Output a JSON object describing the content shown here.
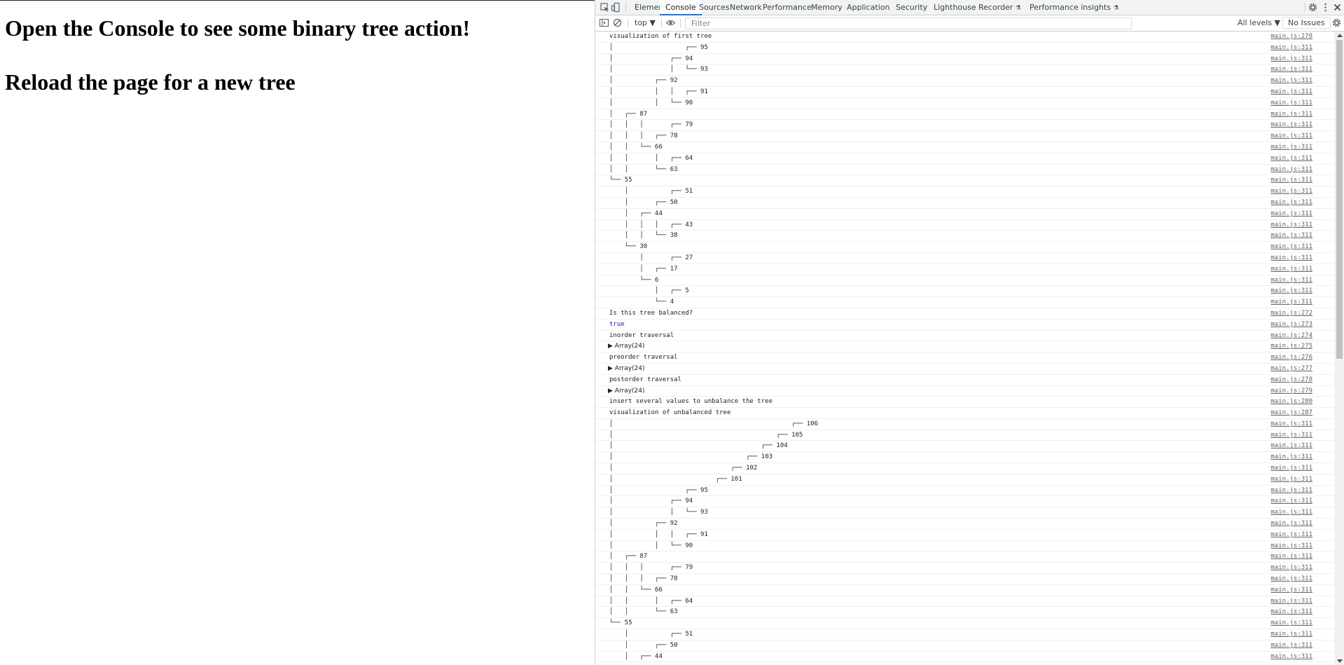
{
  "page": {
    "heading1": "Open the Console to see some binary tree action!",
    "heading2": "Reload the page for a new tree"
  },
  "devtools": {
    "tabs": [
      "Elements",
      "Console",
      "Sources",
      "Network",
      "Performance",
      "Memory",
      "Application",
      "Security",
      "Lighthouse",
      "Recorder",
      "Performance insights"
    ],
    "active_tab": "Console",
    "context": "top ▼",
    "filter_placeholder": "Filter",
    "levels": "All levels ▼",
    "issues": "No Issues"
  },
  "console": [
    {
      "text": "visualization of first tree",
      "src": "main.js:270"
    },
    {
      "text": "│                   ┌── 95",
      "src": "main.js:311"
    },
    {
      "text": "│               ┌── 94",
      "src": "main.js:311"
    },
    {
      "text": "│               │   └── 93",
      "src": "main.js:311"
    },
    {
      "text": "│           ┌── 92",
      "src": "main.js:311"
    },
    {
      "text": "│           │   │   ┌── 91",
      "src": "main.js:311"
    },
    {
      "text": "│           │   └── 90",
      "src": "main.js:311"
    },
    {
      "text": "│   ┌── 87",
      "src": "main.js:311"
    },
    {
      "text": "│   │   │       ┌── 79",
      "src": "main.js:311"
    },
    {
      "text": "│   │   │   ┌── 78",
      "src": "main.js:311"
    },
    {
      "text": "│   │   └── 66",
      "src": "main.js:311"
    },
    {
      "text": "│   │       │   ┌── 64",
      "src": "main.js:311"
    },
    {
      "text": "│   │       └── 63",
      "src": "main.js:311"
    },
    {
      "text": "└── 55",
      "src": "main.js:311"
    },
    {
      "text": "    │           ┌── 51",
      "src": "main.js:311"
    },
    {
      "text": "    │       ┌── 50",
      "src": "main.js:311"
    },
    {
      "text": "    │   ┌── 44",
      "src": "main.js:311"
    },
    {
      "text": "    │   │   │   ┌── 43",
      "src": "main.js:311"
    },
    {
      "text": "    │   │   └── 38",
      "src": "main.js:311"
    },
    {
      "text": "    └── 30",
      "src": "main.js:311"
    },
    {
      "text": "        │       ┌── 27",
      "src": "main.js:311"
    },
    {
      "text": "        │   ┌── 17",
      "src": "main.js:311"
    },
    {
      "text": "        └── 6",
      "src": "main.js:311"
    },
    {
      "text": "            │   ┌── 5",
      "src": "main.js:311"
    },
    {
      "text": "            └── 4",
      "src": "main.js:311"
    },
    {
      "text": "Is this tree balanced?",
      "src": "main.js:272"
    },
    {
      "text": "true",
      "src": "main.js:273",
      "kind": "bool"
    },
    {
      "text": "inorder traversal",
      "src": "main.js:274"
    },
    {
      "text": "▶ Array(24)",
      "src": "main.js:275",
      "kind": "arr"
    },
    {
      "text": "preorder traversal",
      "src": "main.js:276"
    },
    {
      "text": "▶ Array(24)",
      "src": "main.js:277",
      "kind": "arr"
    },
    {
      "text": "postorder traversal",
      "src": "main.js:278"
    },
    {
      "text": "▶ Array(24)",
      "src": "main.js:279",
      "kind": "arr"
    },
    {
      "text": "insert several values to unbalance the tree",
      "src": "main.js:280"
    },
    {
      "text": "visualization of unbalanced tree",
      "src": "main.js:287"
    },
    {
      "text": "│                                               ┌── 106",
      "src": "main.js:311"
    },
    {
      "text": "│                                           ┌── 105",
      "src": "main.js:311"
    },
    {
      "text": "│                                       ┌── 104",
      "src": "main.js:311"
    },
    {
      "text": "│                                   ┌── 103",
      "src": "main.js:311"
    },
    {
      "text": "│                               ┌── 102",
      "src": "main.js:311"
    },
    {
      "text": "│                           ┌── 101",
      "src": "main.js:311"
    },
    {
      "text": "│                   ┌── 95",
      "src": "main.js:311"
    },
    {
      "text": "│               ┌── 94",
      "src": "main.js:311"
    },
    {
      "text": "│               │   └── 93",
      "src": "main.js:311"
    },
    {
      "text": "│           ┌── 92",
      "src": "main.js:311"
    },
    {
      "text": "│           │   │   ┌── 91",
      "src": "main.js:311"
    },
    {
      "text": "│           │   └── 90",
      "src": "main.js:311"
    },
    {
      "text": "│   ┌── 87",
      "src": "main.js:311"
    },
    {
      "text": "│   │   │       ┌── 79",
      "src": "main.js:311"
    },
    {
      "text": "│   │   │   ┌── 78",
      "src": "main.js:311"
    },
    {
      "text": "│   │   └── 66",
      "src": "main.js:311"
    },
    {
      "text": "│   │       │   ┌── 64",
      "src": "main.js:311"
    },
    {
      "text": "│   │       └── 63",
      "src": "main.js:311"
    },
    {
      "text": "└── 55",
      "src": "main.js:311"
    },
    {
      "text": "    │           ┌── 51",
      "src": "main.js:311"
    },
    {
      "text": "    │       ┌── 50",
      "src": "main.js:311"
    },
    {
      "text": "    │   ┌── 44",
      "src": "main.js:311"
    }
  ]
}
